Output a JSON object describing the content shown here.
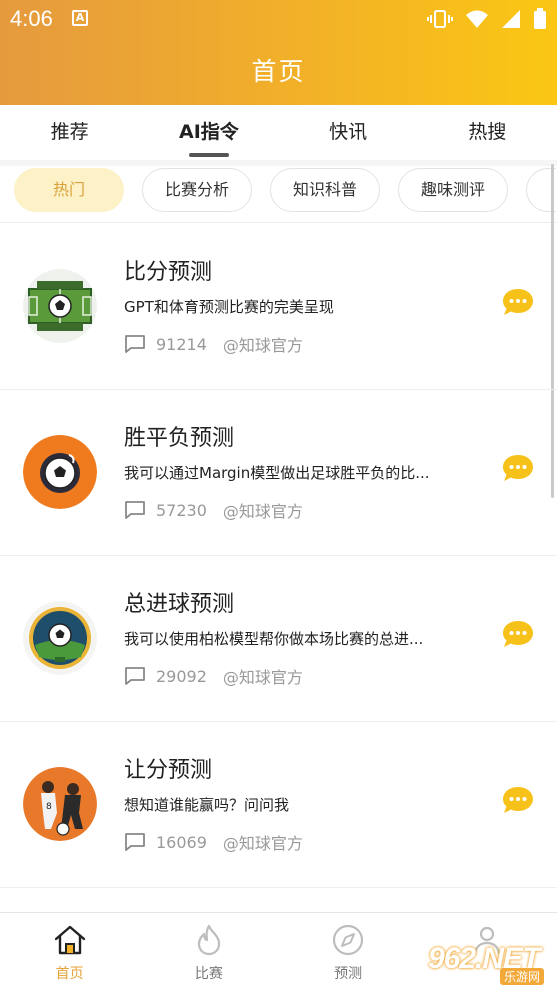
{
  "status": {
    "time": "4:06",
    "notification_icon": "A"
  },
  "header": {
    "title": "首页"
  },
  "tabs": [
    {
      "label": "推荐",
      "active": false
    },
    {
      "label": "AI指令",
      "active": true
    },
    {
      "label": "快讯",
      "active": false
    },
    {
      "label": "热搜",
      "active": false
    }
  ],
  "chips": [
    {
      "label": "热门",
      "active": true
    },
    {
      "label": "比赛分析",
      "active": false
    },
    {
      "label": "知识科普",
      "active": false
    },
    {
      "label": "趣味测评",
      "active": false
    }
  ],
  "items": [
    {
      "title": "比分预测",
      "desc": "GPT和体育预测比赛的完美呈现",
      "count": "91214",
      "author": "@知球官方",
      "avatar": "soccer-field-avatar"
    },
    {
      "title": "胜平负预测",
      "desc": "我可以通过Margin模型做出足球胜平负的比...",
      "count": "57230",
      "author": "@知球官方",
      "avatar": "soccer-ball-orange-avatar"
    },
    {
      "title": "总进球预测",
      "desc": "我可以使用柏松模型帮你做本场比赛的总进...",
      "count": "29092",
      "author": "@知球官方",
      "avatar": "stadium-badge-avatar"
    },
    {
      "title": "让分预测",
      "desc": "想知道谁能赢吗？问问我",
      "count": "16069",
      "author": "@知球官方",
      "avatar": "players-illustration-avatar"
    }
  ],
  "bottom_nav": [
    {
      "label": "首页",
      "icon": "home-icon",
      "active": true
    },
    {
      "label": "比赛",
      "icon": "flame-icon",
      "active": false
    },
    {
      "label": "预测",
      "icon": "compass-icon",
      "active": false
    },
    {
      "label": "",
      "icon": "profile-icon",
      "active": false
    }
  ],
  "watermark": {
    "text": "962.NET",
    "sub": "乐游网"
  },
  "colors": {
    "accent": "#f2b128",
    "chip_active_bg": "#fdf1c8",
    "chat_icon": "#f6c21a",
    "nav_active": "#e8a23a"
  }
}
